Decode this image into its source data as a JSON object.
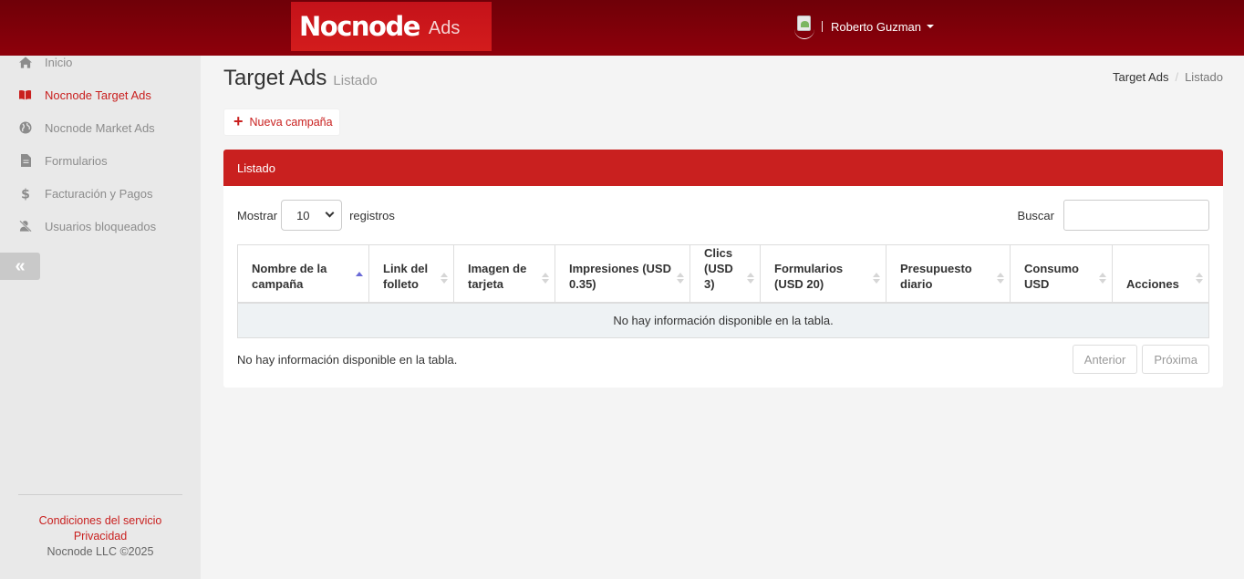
{
  "brand": {
    "name": "Nocnode",
    "suffix": "Ads"
  },
  "user": {
    "name": "Roberto Guzman"
  },
  "sidebar": {
    "items": [
      {
        "label": "Inicio",
        "icon": "home-icon",
        "active": false
      },
      {
        "label": "Nocnode Target Ads",
        "icon": "book-icon",
        "active": true
      },
      {
        "label": "Nocnode Market Ads",
        "icon": "globe-icon",
        "active": false
      },
      {
        "label": "Formularios",
        "icon": "file-icon",
        "active": false
      },
      {
        "label": "Facturación y Pagos",
        "icon": "dollar-icon",
        "active": false
      },
      {
        "label": "Usuarios bloqueados",
        "icon": "user-blocked-icon",
        "active": false
      }
    ],
    "collapse_label": "«",
    "footer": {
      "terms": "Condiciones del servicio",
      "privacy": "Privacidad",
      "copyright": "Nocnode LLC ©2025"
    }
  },
  "page": {
    "title": "Target Ads",
    "subtitle": "Listado",
    "breadcrumb": [
      "Target Ads",
      "Listado"
    ],
    "new_button": "Nueva campaña"
  },
  "panel": {
    "title": "Listado",
    "show_label": "Mostrar",
    "page_size": "10",
    "records_label": "registros",
    "search_label": "Buscar",
    "columns": [
      "Nombre de la campaña",
      "Link del folleto",
      "Imagen de tarjeta",
      "Impresiones (USD 0.35)",
      "Clics (USD 3)",
      "Formularios (USD 20)",
      "Presupuesto diario",
      "Consumo USD",
      "Acciones"
    ],
    "empty_message": "No hay información disponible en la tabla.",
    "info": "No hay información disponible en la tabla.",
    "prev": "Anterior",
    "next": "Próxima"
  },
  "colors": {
    "brand_red": "#c9201f",
    "topbar": "#7d0009"
  }
}
